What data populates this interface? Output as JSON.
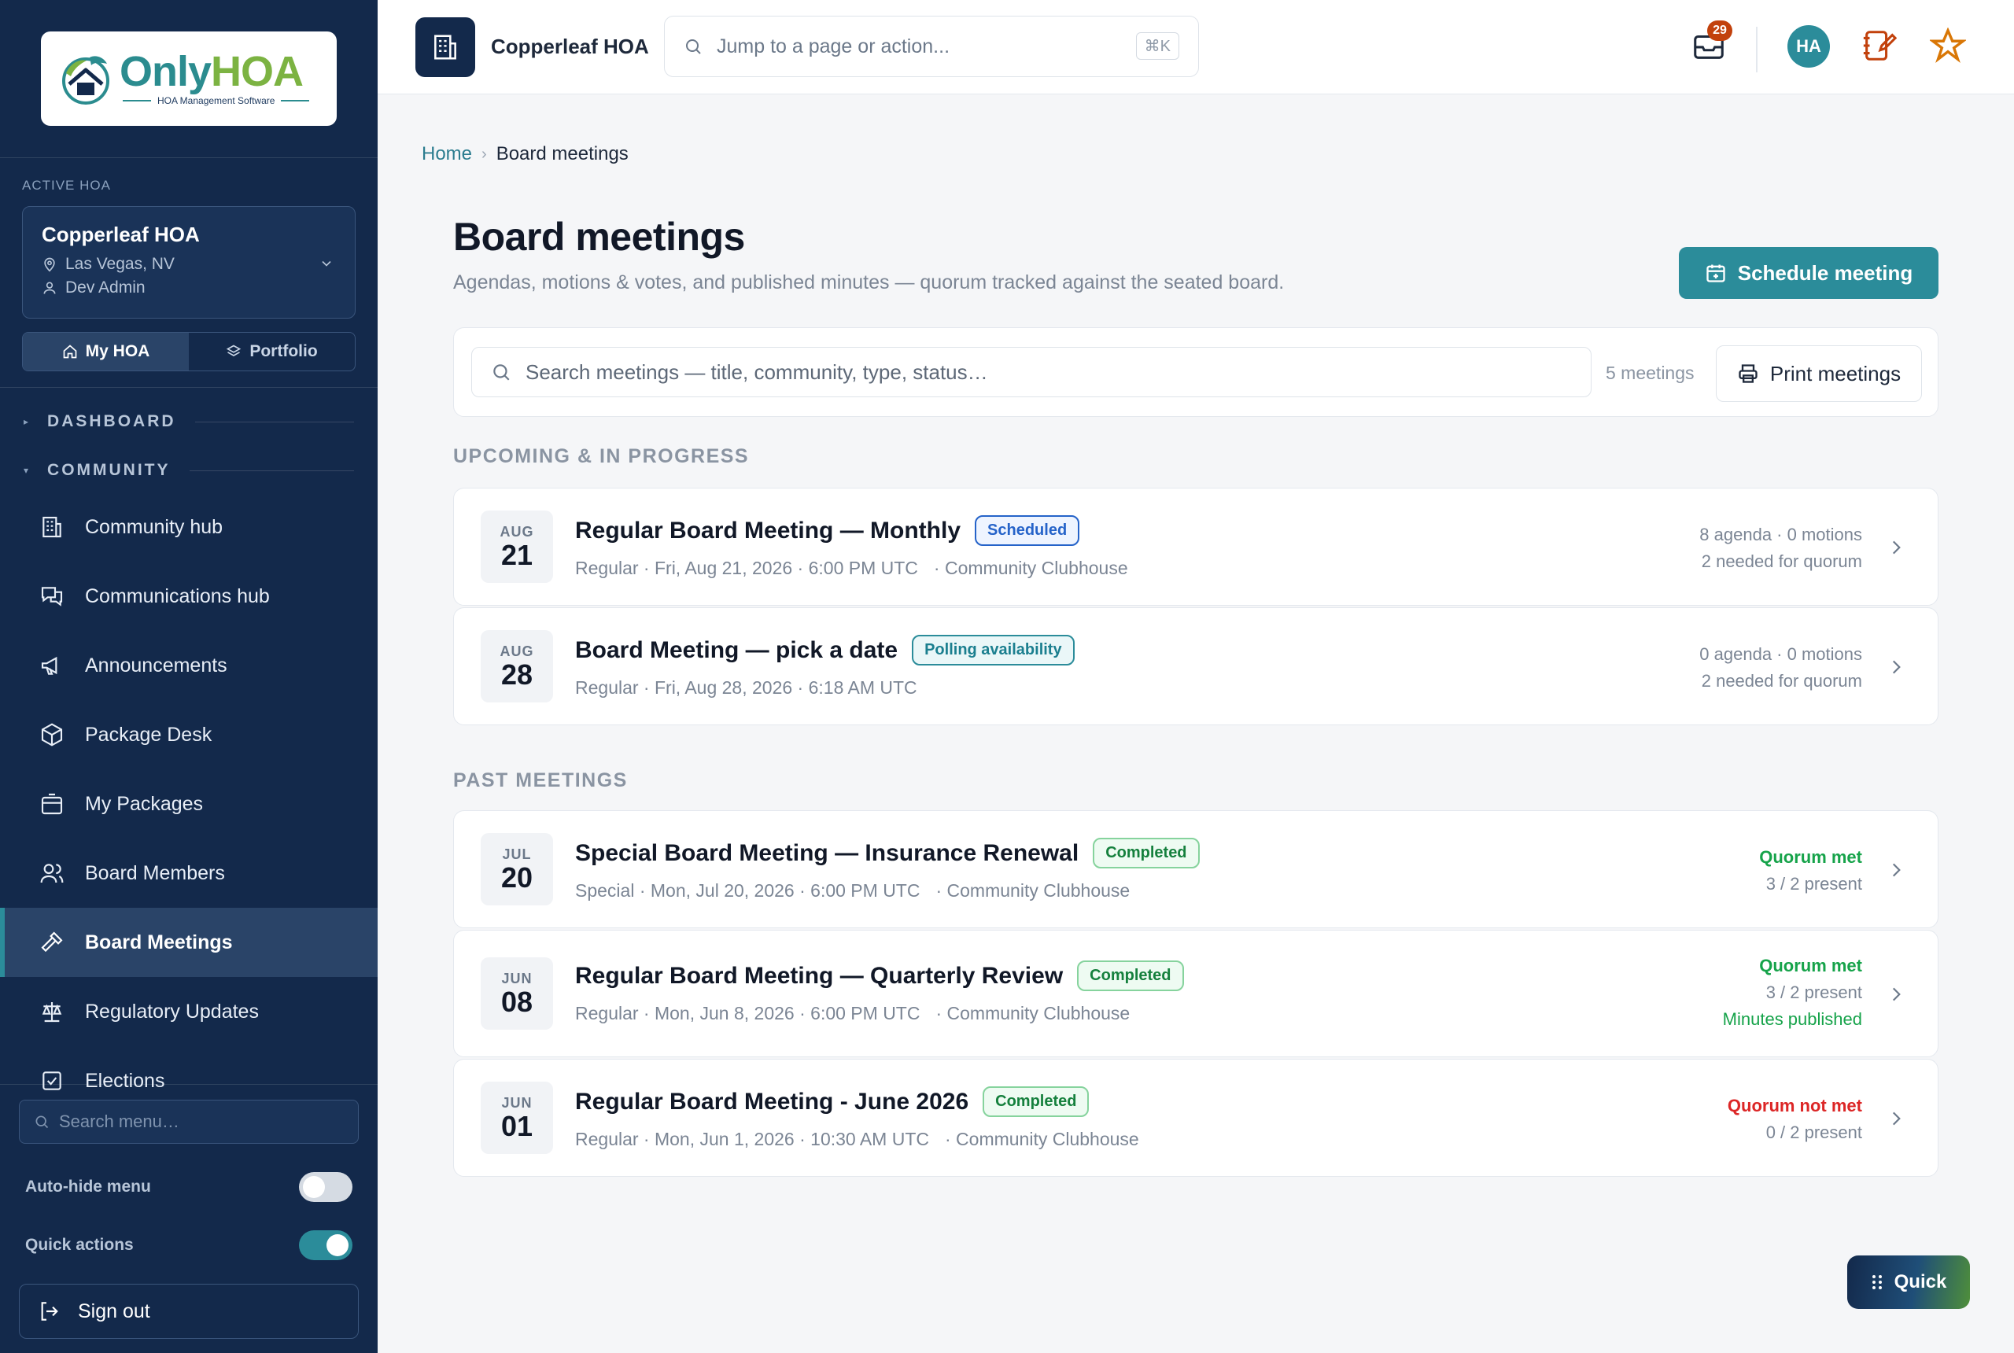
{
  "brand": {
    "word_only": "Only",
    "word_hoa": "HOA",
    "tagline": "HOA Management Software"
  },
  "sidebar": {
    "active_label": "ACTIVE HOA",
    "hoa": {
      "name": "Copperleaf HOA",
      "location": "Las Vegas, NV",
      "user": "Dev Admin"
    },
    "segment": {
      "my_hoa": "My HOA",
      "portfolio": "Portfolio"
    },
    "sections": {
      "dashboard": "DASHBOARD",
      "community": "COMMUNITY"
    },
    "items": [
      {
        "label": "Community hub"
      },
      {
        "label": "Communications hub"
      },
      {
        "label": "Announcements"
      },
      {
        "label": "Package Desk"
      },
      {
        "label": "My Packages"
      },
      {
        "label": "Board Members"
      },
      {
        "label": "Board Meetings"
      },
      {
        "label": "Regulatory Updates"
      },
      {
        "label": "Elections"
      }
    ],
    "search_placeholder": "Search menu…",
    "auto_hide": {
      "label": "Auto-hide menu",
      "on": false
    },
    "quick_actions": {
      "label": "Quick actions",
      "on": true
    },
    "sign_out": "Sign out"
  },
  "topbar": {
    "org_name": "Copperleaf HOA",
    "jump_placeholder": "Jump to a page or action...",
    "shortcut": "⌘K",
    "inbox_badge": "29",
    "avatar_initials": "HA"
  },
  "breadcrumb": {
    "home": "Home",
    "current": "Board meetings"
  },
  "page": {
    "title": "Board meetings",
    "subtitle": "Agendas, motions & votes, and published minutes — quorum tracked against the seated board.",
    "schedule_button": "Schedule meeting",
    "search_placeholder": "Search meetings — title, community, type, status…",
    "count": "5 meetings",
    "print_button": "Print meetings"
  },
  "groups": {
    "upcoming": "UPCOMING & IN PROGRESS",
    "past": "PAST MEETINGS"
  },
  "upcoming": [
    {
      "mon": "AUG",
      "day": "21",
      "title": "Regular Board Meeting — Monthly",
      "status": "Scheduled",
      "status_kind": "scheduled",
      "meta": "Regular · Fri, Aug 21, 2026 · 6:00 PM UTC",
      "location": "· Community Clubhouse",
      "r1": "8 agenda · 0 motions",
      "r2": "2 needed for quorum"
    },
    {
      "mon": "AUG",
      "day": "28",
      "title": "Board Meeting — pick a date",
      "status": "Polling availability",
      "status_kind": "polling",
      "meta": "Regular · Fri, Aug 28, 2026 · 6:18 AM UTC",
      "location": "",
      "r1": "0 agenda · 0 motions",
      "r2": "2 needed for quorum"
    }
  ],
  "past": [
    {
      "mon": "JUL",
      "day": "20",
      "title": "Special Board Meeting — Insurance Renewal",
      "status": "Completed",
      "meta": "Special · Mon, Jul 20, 2026 · 6:00 PM UTC",
      "location": "· Community Clubhouse",
      "quorum": "Quorum met",
      "present": "3 / 2 present",
      "minutes": ""
    },
    {
      "mon": "JUN",
      "day": "08",
      "title": "Regular Board Meeting — Quarterly Review",
      "status": "Completed",
      "meta": "Regular · Mon, Jun 8, 2026 · 6:00 PM UTC",
      "location": "· Community Clubhouse",
      "quorum": "Quorum met",
      "present": "3 / 2 present",
      "minutes": "Minutes published"
    },
    {
      "mon": "JUN",
      "day": "01",
      "title": "Regular Board Meeting - June 2026",
      "status": "Completed",
      "meta": "Regular · Mon, Jun 1, 2026 · 10:30 AM UTC",
      "location": "· Community Clubhouse",
      "quorum": "Quorum not met",
      "present": "0 / 2 present",
      "minutes": ""
    }
  ],
  "quick_button": "Quick",
  "colors": {
    "sidebar": "#13294b",
    "accent": "#2b8c9a",
    "success": "#16a34a",
    "danger": "#dc2626",
    "scheduled": "#2563c9"
  }
}
